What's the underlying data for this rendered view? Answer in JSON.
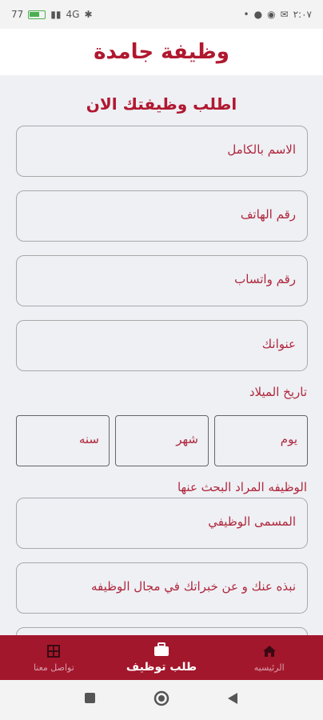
{
  "status_bar": {
    "time": "٢:٠٧",
    "battery": "77",
    "network": "4G"
  },
  "app": {
    "title": "وظيفة جامدة"
  },
  "form": {
    "heading": "اطلب وظيفتك الان",
    "full_name_placeholder": "الاسم بالكامل",
    "phone_placeholder": "رقم الهاتف",
    "whatsapp_placeholder": "رقم واتساب",
    "address_placeholder": "عنوانك",
    "dob_label": "تاريخ الميلاد",
    "day_placeholder": "يوم",
    "month_placeholder": "شهر",
    "year_placeholder": "سنه",
    "job_label": "الوظيفه المراد البحث عنها",
    "job_title_placeholder": "المسمى الوظيفي",
    "bio_placeholder": "نبذه عنك و عن خبراتك في مجال الوظيفه"
  },
  "bottom_nav": {
    "items": [
      {
        "label": "الرئيسيه",
        "icon": "home-icon"
      },
      {
        "label": "طلب توظيف",
        "icon": "briefcase-icon",
        "active": true
      },
      {
        "label": "تواصل معنا",
        "icon": "grid-icon"
      }
    ]
  },
  "colors": {
    "accent": "#b0182f",
    "nav_bg": "#a3172c",
    "page_bg": "#eef0f4"
  }
}
